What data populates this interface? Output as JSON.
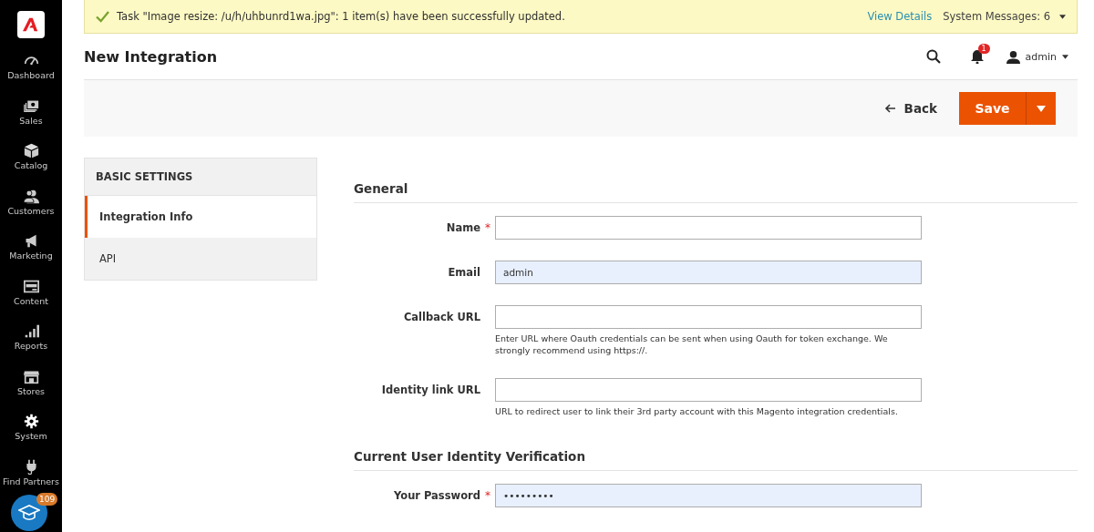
{
  "sidebar": {
    "items": [
      {
        "label": "Dashboard",
        "selected": false
      },
      {
        "label": "Sales",
        "selected": false
      },
      {
        "label": "Catalog",
        "selected": false
      },
      {
        "label": "Customers",
        "selected": false
      },
      {
        "label": "Marketing",
        "selected": false
      },
      {
        "label": "Content",
        "selected": false
      },
      {
        "label": "Reports",
        "selected": false
      },
      {
        "label": "Stores",
        "selected": false
      },
      {
        "label": "System",
        "selected": false
      },
      {
        "label": "Find Partners",
        "selected": false
      }
    ]
  },
  "help_button": {
    "badge": "109"
  },
  "message": {
    "text": "Task \"Image resize: /u/h/uhbunrd1wa.jpg\": 1 item(s) have been successfully updated.",
    "link": "View Details",
    "system_messages": "System Messages: 6"
  },
  "header": {
    "title": "New Integration",
    "notifications": "1",
    "user": "admin"
  },
  "actions": {
    "back": "Back",
    "save": "Save"
  },
  "tabs": {
    "title": "BASIC SETTINGS",
    "items": [
      {
        "label": "Integration Info",
        "selected": true
      },
      {
        "label": "API",
        "selected": false
      }
    ]
  },
  "sections": [
    {
      "title": "General",
      "fields": [
        {
          "label": "Name",
          "required_mark": "*",
          "autofilled": false
        },
        {
          "label": "Email",
          "value": "admin",
          "autofilled": true
        },
        {
          "label": "Callback URL",
          "autofilled": false,
          "note": "Enter URL where Oauth credentials can be sent when using Oauth for token exchange. We strongly recommend using https://."
        },
        {
          "label": "Identity link URL",
          "autofilled": false,
          "note": "URL to redirect user to link their 3rd party account with this Magento integration credentials."
        }
      ]
    },
    {
      "title": "Current User Identity Verification",
      "fields": [
        {
          "label": "Your Password",
          "required_mark": "*",
          "value": "•••••••••",
          "autofilled": true
        }
      ]
    }
  ]
}
